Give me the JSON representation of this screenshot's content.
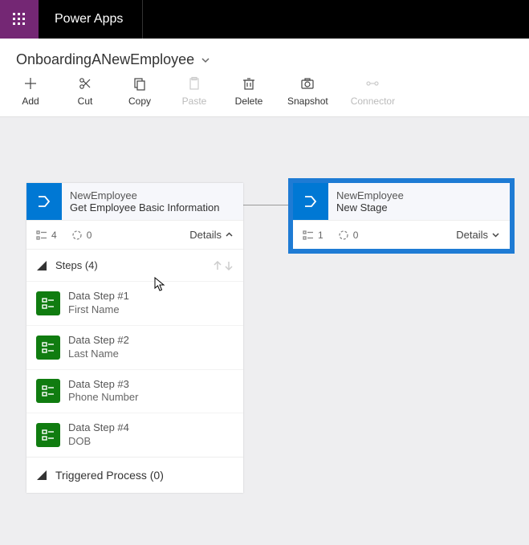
{
  "header": {
    "app_title": "Power Apps"
  },
  "breadcrumb": {
    "process_name": "OnboardingANewEmployee"
  },
  "toolbar": {
    "add": "Add",
    "cut": "Cut",
    "copy": "Copy",
    "paste": "Paste",
    "delete": "Delete",
    "snapshot": "Snapshot",
    "connector": "Connector"
  },
  "stage1": {
    "entity": "NewEmployee",
    "name": "Get Employee Basic Information",
    "steps_count": "4",
    "dur_count": "0",
    "details_label": "Details",
    "steps_header": "Steps (4)",
    "steps": [
      {
        "title": "Data Step #1",
        "field": "First Name"
      },
      {
        "title": "Data Step #2",
        "field": "Last Name"
      },
      {
        "title": "Data Step #3",
        "field": "Phone Number"
      },
      {
        "title": "Data Step #4",
        "field": "DOB"
      }
    ],
    "triggered_label": "Triggered Process (0)"
  },
  "stage2": {
    "entity": "NewEmployee",
    "name": "New Stage",
    "steps_count": "1",
    "dur_count": "0",
    "details_label": "Details"
  }
}
